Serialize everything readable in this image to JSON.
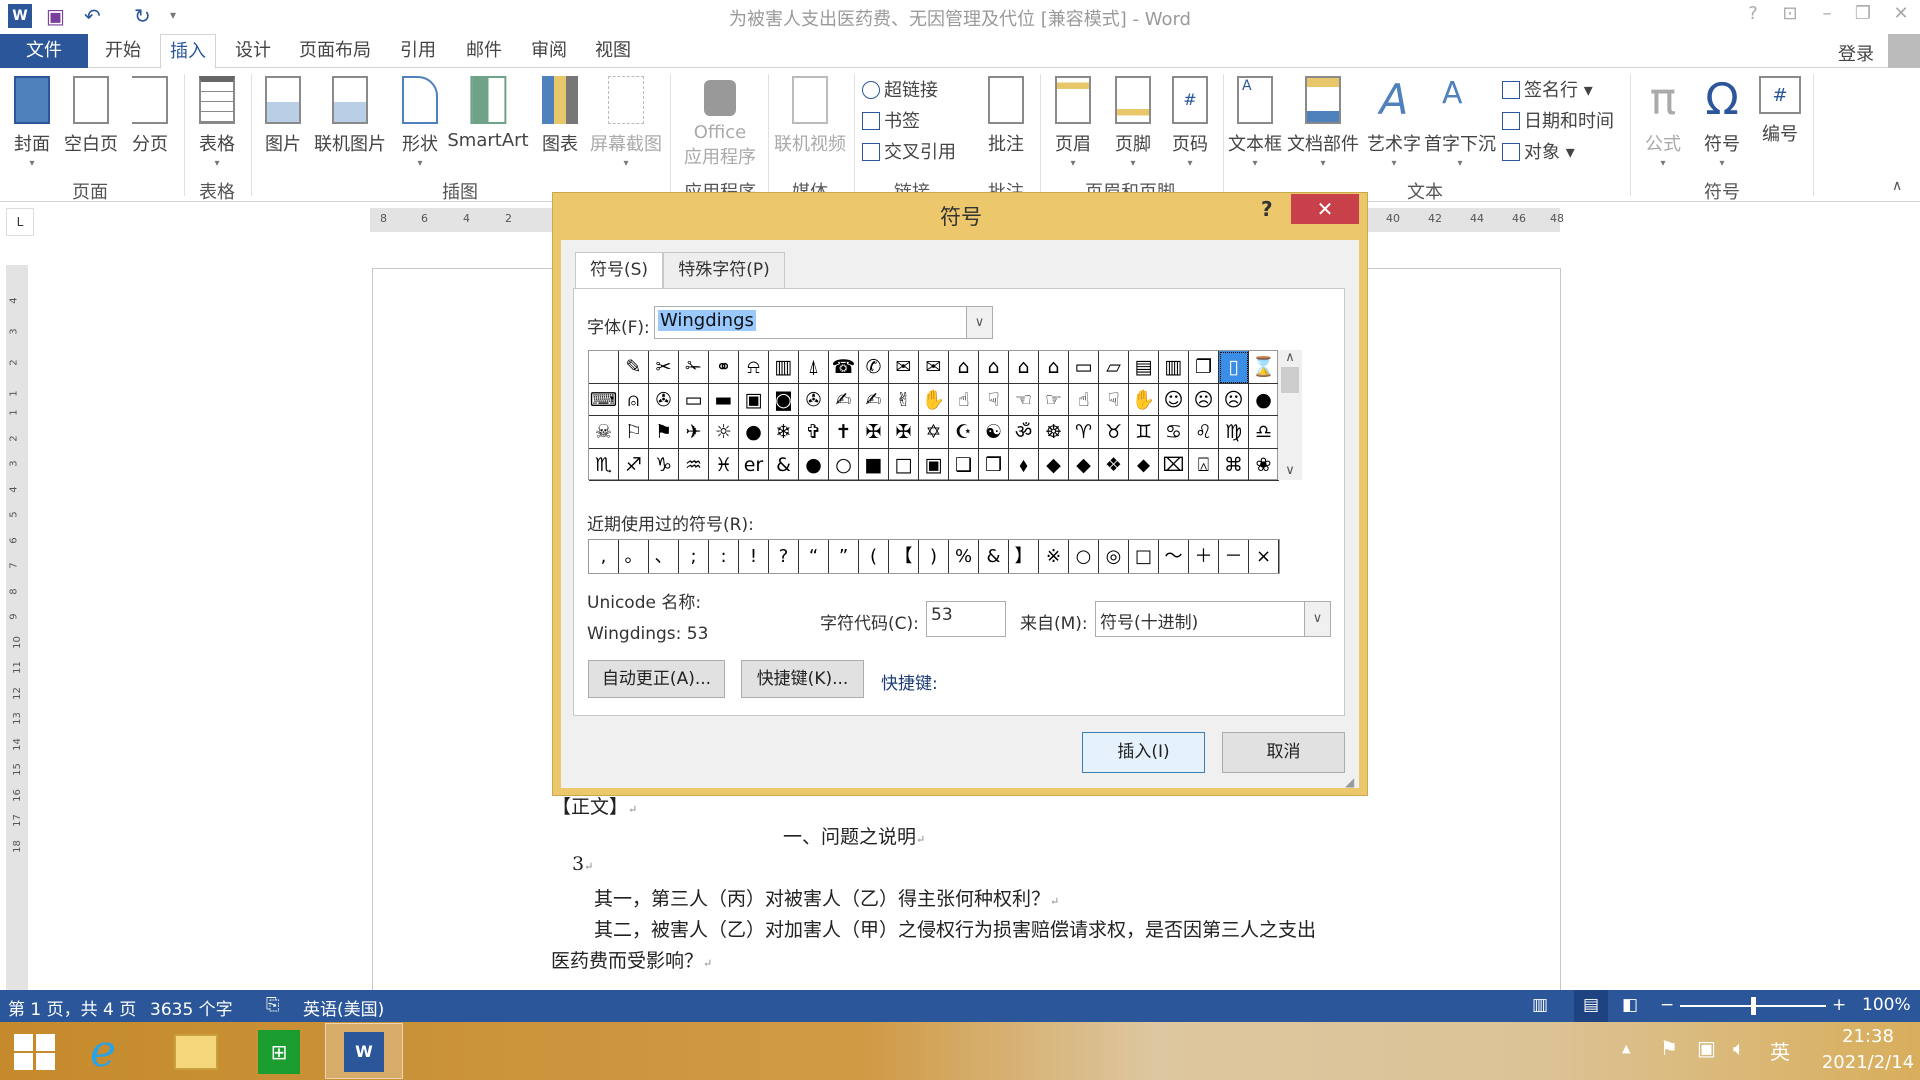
{
  "window": {
    "title": "为被害人支出医药费、无因管理及代位 [兼容模式] - Word",
    "help": "?",
    "login": "登录"
  },
  "tabs": [
    "文件",
    "开始",
    "插入",
    "设计",
    "页面布局",
    "引用",
    "邮件",
    "审阅",
    "视图"
  ],
  "ribbon": {
    "buttons": {
      "cover": "封面",
      "blank": "空白页",
      "pagebreak": "分页",
      "table": "表格",
      "picture": "图片",
      "online_picture": "联机图片",
      "shapes": "形状",
      "smartart": "SmartArt",
      "chart": "图表",
      "screenshot": "屏幕截图",
      "office_apps_1": "Office",
      "office_apps_2": "应用程序",
      "online_video": "联机视频",
      "hyperlink": "超链接",
      "bookmark": "书签",
      "crossref": "交叉引用",
      "comment": "批注",
      "header": "页眉",
      "footer": "页脚",
      "pagenum": "页码",
      "textbox": "文本框",
      "quickparts": "文档部件",
      "wordart": "艺术字",
      "dropcap": "首字下沉",
      "signature": "签名行",
      "datetime": "日期和时间",
      "object": "对象",
      "equation": "公式",
      "symbol": "符号",
      "number": "编号"
    },
    "groups": {
      "pages": "页面",
      "tables": "表格",
      "illustrations": "插图",
      "apps": "应用程序",
      "media": "媒体",
      "links": "链接",
      "comments": "批注",
      "headerfooter": "页眉和页脚",
      "text": "文本",
      "symbols": "符号"
    }
  },
  "ruler": {
    "tab_selector": "L",
    "left": [
      "8",
      "6",
      "4",
      "2"
    ],
    "right": [
      "40",
      "42",
      "44",
      "46",
      "48"
    ],
    "vertical": [
      "4",
      "3",
      "2",
      "1",
      "1",
      "2",
      "3",
      "4",
      "5",
      "6",
      "7",
      "8",
      "9",
      "10",
      "11",
      "12",
      "13",
      "14",
      "15",
      "16",
      "17",
      "18"
    ]
  },
  "document": {
    "lines": [
      "【正文】",
      "一、问题之说明",
      "3",
      "其一，第三人（丙）对被害人（乙）得主张何种权利？",
      "其二，被害人（乙）对加害人（甲）之侵权行为损害赔偿请求权，是否因第三人之支出",
      "医药费而受影响？"
    ],
    "para_mark": "↵"
  },
  "dialog": {
    "title": "符号",
    "help": "?",
    "close": "✕",
    "tabs": [
      "符号(S)",
      "特殊字符(P)"
    ],
    "font_label": "字体(F):",
    "font_value": "Wingdings",
    "symbols": [
      [
        "",
        "✎",
        "✂",
        "✁",
        "⚭",
        "⍾",
        "▥",
        "⍋",
        "☎",
        "✆",
        "✉",
        "✉",
        "⌂",
        "⌂",
        "⌂",
        "⌂",
        "▭",
        "▱",
        "▤",
        "▥",
        "❐",
        "▯",
        "⌛"
      ],
      [
        "⌨",
        "⍝",
        "✇",
        "▭",
        "▬",
        "▣",
        "◙",
        "✇",
        "✍",
        "✍",
        "✌",
        "✋",
        "☝",
        "☟",
        "☜",
        "☞",
        "☝",
        "☟",
        "✋",
        "☺",
        "☹",
        "☹",
        "●"
      ],
      [
        "☠",
        "⚐",
        "⚑",
        "✈",
        "☼",
        "●",
        "❄",
        "✞",
        "✝",
        "✠",
        "✠",
        "✡",
        "☪",
        "☯",
        "ॐ",
        "☸",
        "♈",
        "♉",
        "♊",
        "♋",
        "♌",
        "♍",
        "♎"
      ],
      [
        "♏",
        "♐",
        "♑",
        "♒",
        "♓",
        "er",
        "&",
        "●",
        "○",
        "■",
        "□",
        "▣",
        "❑",
        "❒",
        "⬧",
        "◆",
        "◆",
        "❖",
        "⬥",
        "⌧",
        "⍓",
        "⌘",
        "❀"
      ]
    ],
    "selected": {
      "row": 0,
      "col": 21
    },
    "recent_label": "近期使用过的符号(R):",
    "recent": [
      ",",
      "。",
      "、",
      ";",
      ":",
      "!",
      "?",
      "“",
      "”",
      "(",
      "【",
      ")",
      "%",
      "&",
      "】",
      "※",
      "○",
      "◎",
      "□",
      "～",
      "＋",
      "－",
      "×"
    ],
    "unicode_label": "Unicode 名称:",
    "unicode_value": "Wingdings: 53",
    "code_label": "字符代码(C):",
    "code_value": "53",
    "from_label": "来自(M):",
    "from_value": "符号(十进制)",
    "autocorrect": "自动更正(A)...",
    "shortcut_btn": "快捷键(K)...",
    "shortcut_label": "快捷键:",
    "insert": "插入(I)",
    "cancel": "取消"
  },
  "status": {
    "page": "第 1 页，共 4 页",
    "words": "3635 个字",
    "language": "英语(美国)",
    "zoom": "100%",
    "zoom_level": 100
  },
  "taskbar": {
    "time": "21:38",
    "date": "2021/2/14",
    "ime": "英"
  },
  "colors": {
    "accent": "#2b579a",
    "dialog_frame": "#ecc76b",
    "close": "#c7404a",
    "selection": "#3a8ee6"
  }
}
